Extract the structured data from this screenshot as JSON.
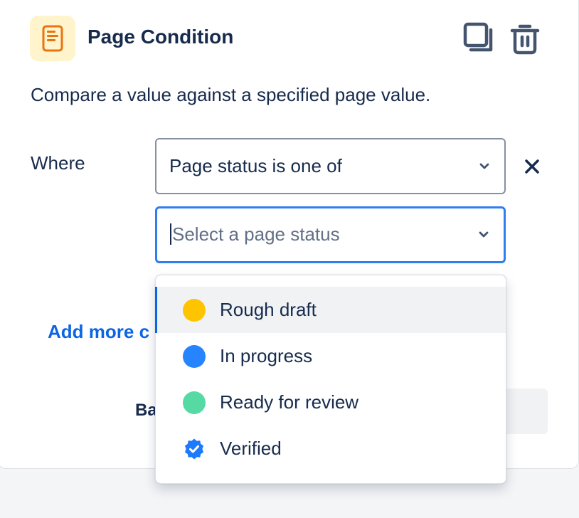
{
  "header": {
    "title": "Page Condition"
  },
  "description": "Compare a value against a specified page value.",
  "condition": {
    "where_label": "Where",
    "selected_value": "Page status is one of"
  },
  "status_select": {
    "placeholder": "Select a page status"
  },
  "dropdown": {
    "options": [
      {
        "label": "Rough draft",
        "color": "#FFC400"
      },
      {
        "label": "In progress",
        "color": "#2684FF"
      },
      {
        "label": "Ready for review",
        "color": "#57D9A3"
      },
      {
        "label": "Verified",
        "color": "#1D7AFC"
      }
    ]
  },
  "add_more_link": "Add more c",
  "back_text": "Ba",
  "colors": {
    "accent": "#0C66E4",
    "focus_border": "#2F7DEE",
    "icon_orange": "#F18D13",
    "icon_tile_bg": "#FFF4CC"
  }
}
